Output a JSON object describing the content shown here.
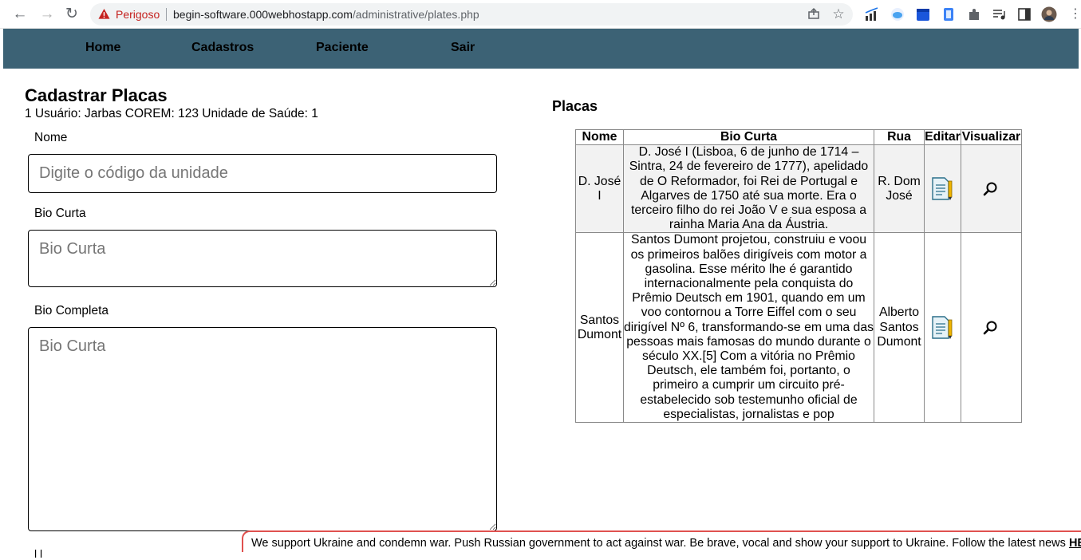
{
  "browser": {
    "security_label": "Perigoso",
    "url_host": "begin-software.000webhostapp.com",
    "url_path": "/administrative/plates.php"
  },
  "nav": {
    "items": [
      "Home",
      "Cadastros",
      "Paciente",
      "Sair"
    ]
  },
  "form": {
    "title": "Cadastrar Placas",
    "user_info": "1 Usuário: Jarbas COREM: 123 Unidade de Saúde: 1",
    "nome_label": "Nome",
    "nome_placeholder": "Digite o código da unidade",
    "bio_curta_label": "Bio Curta",
    "bio_curta_placeholder": "Bio Curta",
    "bio_completa_label": "Bio Completa",
    "bio_completa_placeholder": "Bio Curta",
    "next_label_partial": "l l"
  },
  "placas": {
    "title": "Placas",
    "headers": [
      "Nome",
      "Bio Curta",
      "Rua",
      "Editar",
      "Visualizar"
    ],
    "rows": [
      {
        "nome": "D. José I",
        "bio": "D. José I (Lisboa, 6 de junho de 1714 – Sintra, 24 de fevereiro de 1777), apelidado de O Reformador, foi Rei de Portugal e Algarves de 1750 até sua morte. Era o terceiro filho do rei João V e sua esposa a rainha Maria Ana da Áustria.",
        "rua": "R. Dom José"
      },
      {
        "nome": "Santos Dumont",
        "bio": "Santos Dumont projetou, construiu e voou os primeiros balões dirigíveis com motor a gasolina. Esse mérito lhe é garantido internacionalmente pela conquista do Prêmio Deutsch em 1901, quando em um voo contornou a Torre Eiffel com o seu dirigível Nº 6, transformando-se em uma das pessoas mais famosas do mundo durante o século XX.[5] Com a vitória no Prêmio Deutsch, ele também foi, portanto, o primeiro a cumprir um circuito pré-estabelecido sob testemunho oficial de especialistas, jornalistas e pop",
        "rua": "Alberto Santos Dumont"
      }
    ]
  },
  "banner": {
    "text": "We support Ukraine and condemn war. Push Russian government to act against war. Be brave, vocal and show your support to Ukraine. Follow the latest news ",
    "link": "HERE"
  }
}
